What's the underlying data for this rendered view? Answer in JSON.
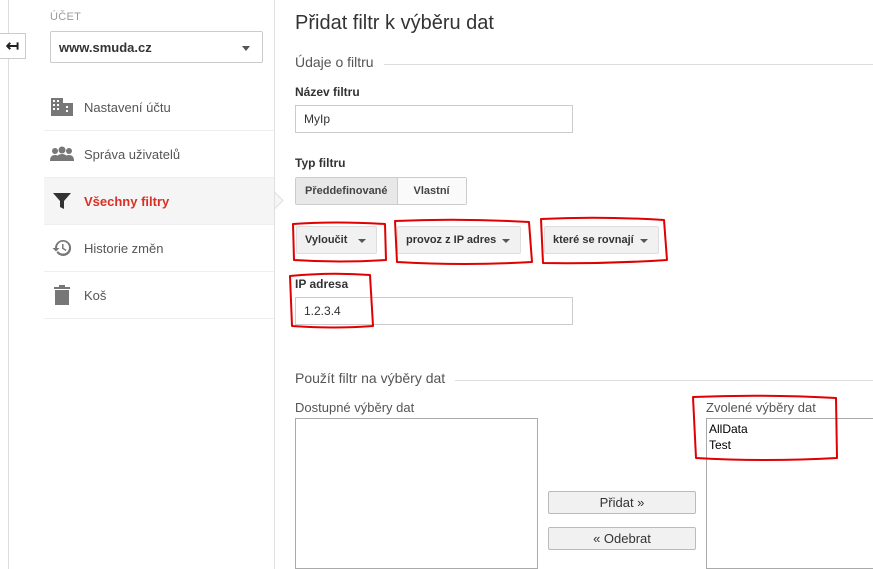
{
  "sidebar": {
    "account_label": "ÚČET",
    "account_value": "www.smuda.cz",
    "items": [
      {
        "label": "Nastavení účtu",
        "icon": "building-icon"
      },
      {
        "label": "Správa uživatelů",
        "icon": "users-icon"
      },
      {
        "label": "Všechny filtry",
        "icon": "filter-icon",
        "active": true
      },
      {
        "label": "Historie změn",
        "icon": "history-icon"
      },
      {
        "label": "Koš",
        "icon": "trash-icon"
      }
    ]
  },
  "main": {
    "title": "Přidat filtr k výběru dat",
    "filter_section": "Údaje o filtru",
    "filter_name_label": "Název filtru",
    "filter_name_value": "MyIp",
    "filter_type_label": "Typ filtru",
    "type_predefined": "Předdefinované",
    "type_custom": "Vlastní",
    "dropdown_exclude": "Vyloučit",
    "dropdown_source": "provoz z IP adres",
    "dropdown_condition": "které se rovnají",
    "ip_label": "IP adresa",
    "ip_value": "1.2.3.4",
    "apply_section": "Použít filtr na výběry dat",
    "available_label": "Dostupné výběry dat",
    "selected_label": "Zvolené výběry dat",
    "selected_views": [
      "AllData",
      "Test"
    ],
    "add_button": "Přidat »",
    "remove_button": "« Odebrat"
  },
  "colors": {
    "accent": "#d93025",
    "annotation": "#e00000"
  }
}
